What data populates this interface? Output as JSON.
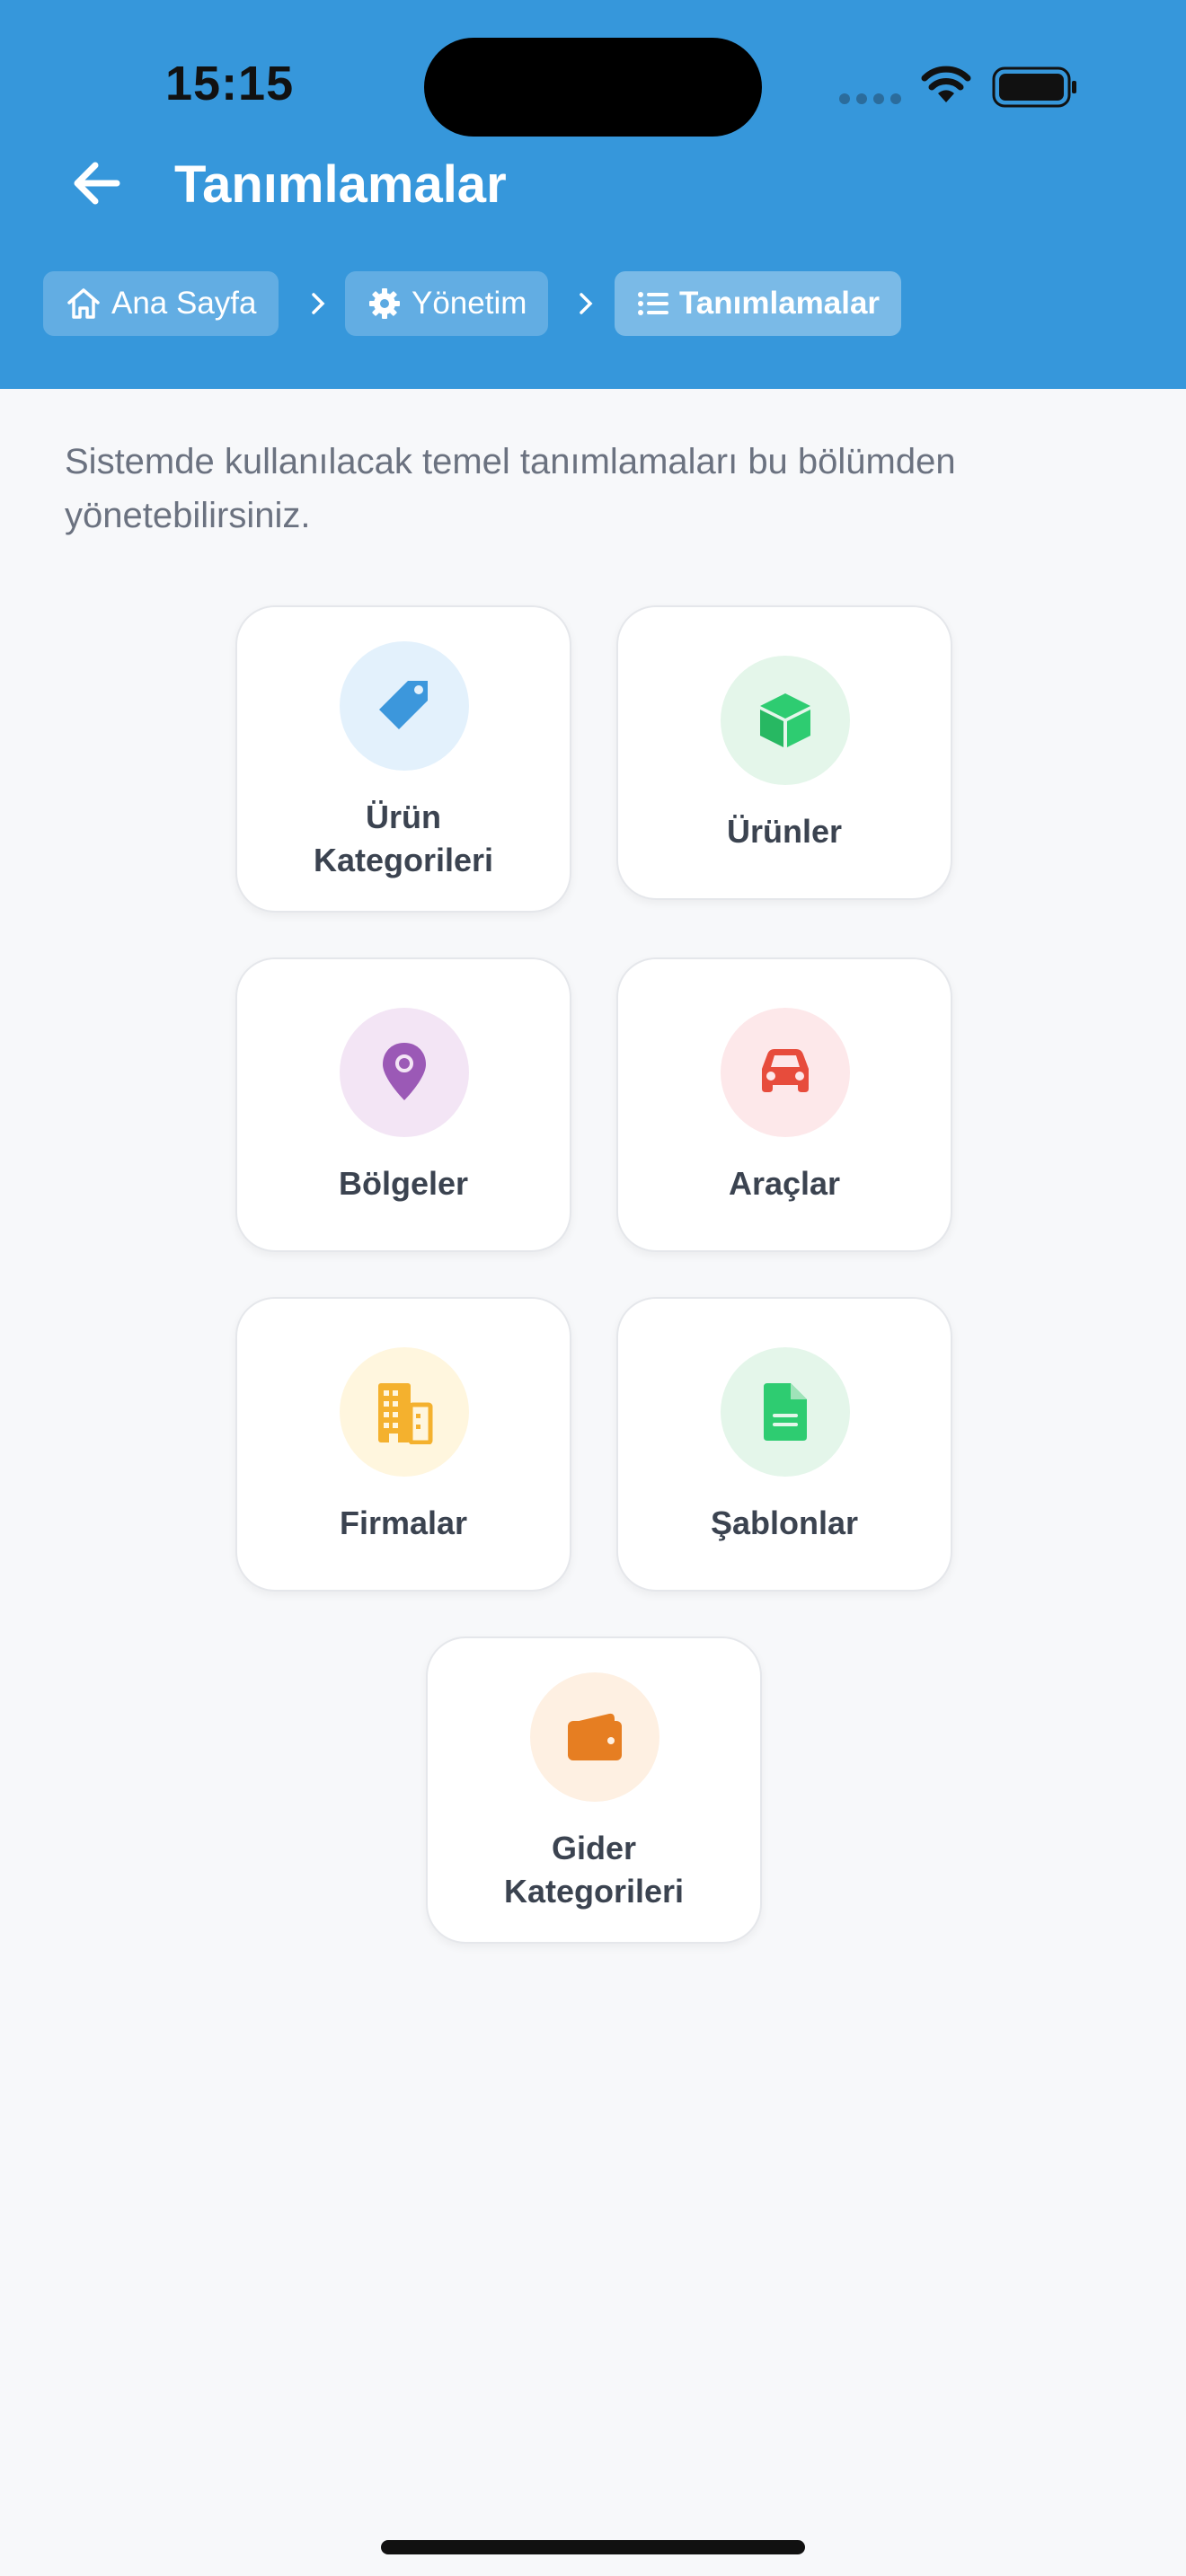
{
  "status_bar": {
    "time": "15:15"
  },
  "header": {
    "title": "Tanımlamalar"
  },
  "breadcrumb": [
    {
      "label": "Ana Sayfa",
      "icon": "home-icon"
    },
    {
      "label": "Yönetim",
      "icon": "gear-icon"
    },
    {
      "label": "Tanımlamalar",
      "icon": "list-icon"
    }
  ],
  "intro": "Sistemde kullanılacak temel tanımlamaları bu bölümden yönetebilirsiniz.",
  "cards": [
    {
      "label_line1": "Ürün",
      "label_line2": "Kategorileri",
      "icon": "tag-icon",
      "color": "#3c97dc",
      "bg": "#e3f1fc"
    },
    {
      "label_line1": "Ürünler",
      "icon": "cube-icon",
      "color": "#2ecc71",
      "bg": "#e4f6ea"
    },
    {
      "label_line1": "Bölgeler",
      "icon": "map-pin-icon",
      "color": "#9b59b6",
      "bg": "#f3e5f5"
    },
    {
      "label_line1": "Araçlar",
      "icon": "car-icon",
      "color": "#e74c3c",
      "bg": "#fde8ea"
    },
    {
      "label_line1": "Firmalar",
      "icon": "building-icon",
      "color": "#f4b12e",
      "bg": "#fff6de"
    },
    {
      "label_line1": "Şablonlar",
      "icon": "document-icon",
      "color": "#2ecc71",
      "bg": "#e4f6ea"
    },
    {
      "label_line1": "Gider",
      "label_line2": "Kategorileri",
      "icon": "wallet-icon",
      "color": "#e67e22",
      "bg": "#fef0e2"
    }
  ]
}
